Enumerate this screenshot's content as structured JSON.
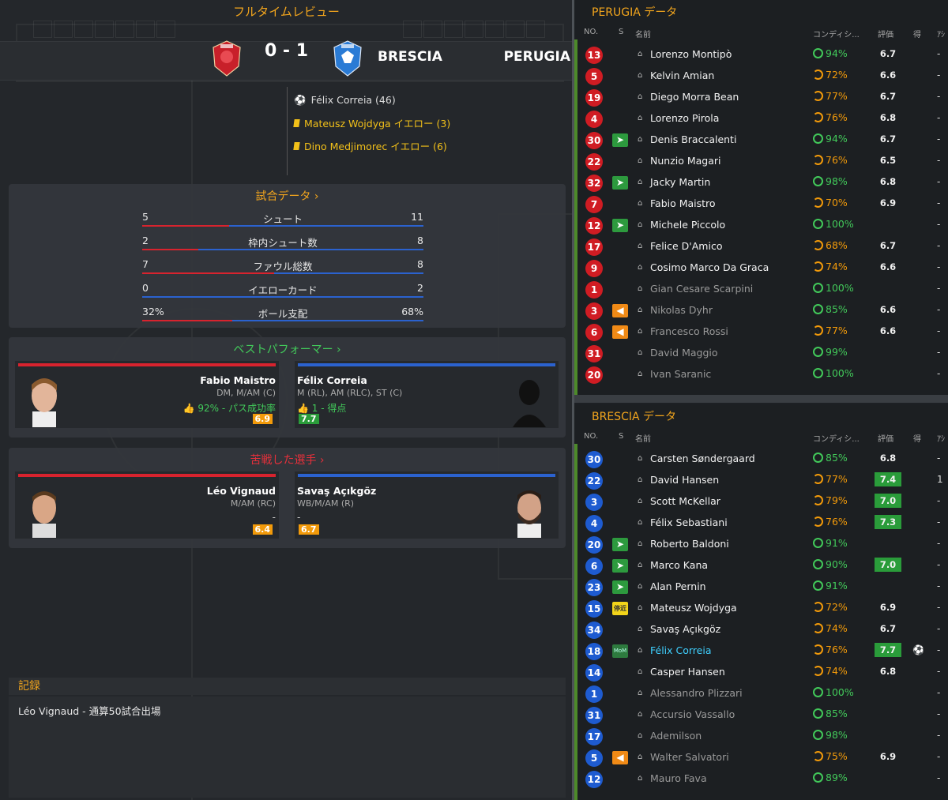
{
  "page_title": "フルタイムレビュー",
  "match": {
    "home_team": "PERUGIA",
    "away_team": "BRESCIA",
    "score": "0 - 1",
    "home_color": "#d8232e",
    "away_color": "#2b62cf"
  },
  "events": [
    {
      "text": "Félix Correia (46)",
      "type": "goal",
      "icon": "ball-icon"
    },
    {
      "text": "Mateusz Wojdyga イエロー (3)",
      "type": "yellow",
      "icon": "yellow-card-icon"
    },
    {
      "text": "Dino Medjimorec イエロー (6)",
      "type": "yellow",
      "icon": "yellow-card-icon"
    }
  ],
  "match_stats": {
    "header": "試合データ",
    "rows": [
      {
        "label": "シュート",
        "home": "5",
        "away": "11",
        "home_share": 0.31
      },
      {
        "label": "枠内シュート数",
        "home": "2",
        "away": "8",
        "home_share": 0.2
      },
      {
        "label": "ファウル総数",
        "home": "7",
        "away": "8",
        "home_share": 0.47
      },
      {
        "label": "イエローカード",
        "home": "0",
        "away": "2",
        "home_share": 0.0
      },
      {
        "label": "ボール支配",
        "home": "32%",
        "away": "68%",
        "home_share": 0.32
      }
    ]
  },
  "best": {
    "header": "ベストパフォーマー",
    "home": {
      "name": "Fabio Maistro",
      "pos": "DM, M/AM (C)",
      "stat": "92% - パス成功率",
      "rating": "6.9"
    },
    "away": {
      "name": "Félix Correia",
      "pos": "M (RL), AM (RLC), ST (C)",
      "stat": "1 - 得点",
      "rating": "7.7"
    }
  },
  "struggled": {
    "header": "苦戦した選手",
    "home": {
      "name": "Léo Vignaud",
      "pos": "M/AM (RC)",
      "stat": "-",
      "rating": "6.4"
    },
    "away": {
      "name": "Savaş Açıkgöz",
      "pos": "WB/M/AM (R)",
      "stat": "-",
      "rating": "6.7"
    }
  },
  "record": {
    "header": "記録",
    "text": "Léo Vignaud - 通算50試合出場"
  },
  "columns": {
    "no": "NO.",
    "s": "S",
    "name": "名前",
    "cond": "コンディシ...",
    "rating": "評価",
    "goals": "得",
    "assists": "ｱｼ"
  },
  "perugia": {
    "title": "PERUGIA データ",
    "players": [
      {
        "no": "13",
        "sub": "",
        "name": "Lorenzo Montipò",
        "cond": "94%",
        "rating": "6.7",
        "goals": "",
        "assists": "-"
      },
      {
        "no": "5",
        "sub": "",
        "name": "Kelvin Amian",
        "cond": "72%",
        "rating": "6.6",
        "goals": "",
        "assists": "-"
      },
      {
        "no": "19",
        "sub": "",
        "name": "Diego Morra Bean",
        "cond": "77%",
        "rating": "6.7",
        "goals": "",
        "assists": "-"
      },
      {
        "no": "4",
        "sub": "",
        "name": "Lorenzo Pirola",
        "cond": "76%",
        "rating": "6.8",
        "goals": "",
        "assists": "-"
      },
      {
        "no": "30",
        "sub": "in",
        "name": "Denis Braccalenti",
        "cond": "94%",
        "rating": "6.7",
        "goals": "",
        "assists": "-"
      },
      {
        "no": "22",
        "sub": "",
        "name": "Nunzio Magari",
        "cond": "76%",
        "rating": "6.5",
        "goals": "",
        "assists": "-"
      },
      {
        "no": "32",
        "sub": "in",
        "name": "Jacky Martin",
        "cond": "98%",
        "rating": "6.8",
        "goals": "",
        "assists": "-"
      },
      {
        "no": "7",
        "sub": "",
        "name": "Fabio Maistro",
        "cond": "70%",
        "rating": "6.9",
        "goals": "",
        "assists": "-"
      },
      {
        "no": "12",
        "sub": "in",
        "name": "Michele Piccolo",
        "cond": "100%",
        "rating": "",
        "goals": "",
        "assists": "-"
      },
      {
        "no": "17",
        "sub": "",
        "name": "Felice D'Amico",
        "cond": "68%",
        "rating": "6.7",
        "goals": "",
        "assists": "-"
      },
      {
        "no": "9",
        "sub": "",
        "name": "Cosimo Marco Da Graca",
        "cond": "74%",
        "rating": "6.6",
        "goals": "",
        "assists": "-"
      },
      {
        "no": "1",
        "sub": "",
        "name": "Gian Cesare Scarpini",
        "cond": "100%",
        "rating": "",
        "goals": "",
        "assists": "-",
        "dim": true
      },
      {
        "no": "3",
        "sub": "out",
        "name": "Nikolas Dyhr",
        "cond": "85%",
        "rating": "6.6",
        "goals": "",
        "assists": "-",
        "dim": true
      },
      {
        "no": "6",
        "sub": "out",
        "name": "Francesco Rossi",
        "cond": "77%",
        "rating": "6.6",
        "goals": "",
        "assists": "-",
        "dim": true
      },
      {
        "no": "31",
        "sub": "",
        "name": "David Maggio",
        "cond": "99%",
        "rating": "",
        "goals": "",
        "assists": "-",
        "dim": true
      },
      {
        "no": "20",
        "sub": "",
        "name": "Ivan Saranic",
        "cond": "100%",
        "rating": "",
        "goals": "",
        "assists": "-",
        "dim": true
      }
    ]
  },
  "brescia": {
    "title": "BRESCIA データ",
    "players": [
      {
        "no": "30",
        "sub": "",
        "name": "Carsten Søndergaard",
        "cond": "85%",
        "rating": "6.8",
        "goals": "",
        "assists": "-"
      },
      {
        "no": "22",
        "sub": "",
        "name": "David Hansen",
        "cond": "77%",
        "rating": "7.4",
        "goals": "",
        "assists": "1",
        "best": true
      },
      {
        "no": "3",
        "sub": "",
        "name": "Scott McKellar",
        "cond": "79%",
        "rating": "7.0",
        "goals": "",
        "assists": "-",
        "best": true
      },
      {
        "no": "4",
        "sub": "",
        "name": "Félix Sebastiani",
        "cond": "76%",
        "rating": "7.3",
        "goals": "",
        "assists": "-",
        "best": true
      },
      {
        "no": "20",
        "sub": "in",
        "name": "Roberto Baldoni",
        "cond": "91%",
        "rating": "",
        "goals": "",
        "assists": "-"
      },
      {
        "no": "6",
        "sub": "in",
        "name": "Marco Kana",
        "cond": "90%",
        "rating": "7.0",
        "goals": "",
        "assists": "-",
        "best": true
      },
      {
        "no": "23",
        "sub": "in",
        "name": "Alan Pernin",
        "cond": "91%",
        "rating": "",
        "goals": "",
        "assists": "-"
      },
      {
        "no": "15",
        "sub": "sus",
        "sub_label": "停近",
        "name": "Mateusz Wojdyga",
        "cond": "72%",
        "rating": "6.9",
        "goals": "",
        "assists": "-"
      },
      {
        "no": "34",
        "sub": "",
        "name": "Savaş Açıkgöz",
        "cond": "74%",
        "rating": "6.7",
        "goals": "",
        "assists": "-"
      },
      {
        "no": "18",
        "sub": "mom",
        "sub_label": "MoM",
        "name": "Félix Correia",
        "cond": "76%",
        "rating": "7.7",
        "goals": "⚽",
        "assists": "-",
        "best": true,
        "hl": true
      },
      {
        "no": "14",
        "sub": "",
        "name": "Casper Hansen",
        "cond": "74%",
        "rating": "6.8",
        "goals": "",
        "assists": "-"
      },
      {
        "no": "1",
        "sub": "",
        "name": "Alessandro Plizzari",
        "cond": "100%",
        "rating": "",
        "goals": "",
        "assists": "-",
        "dim": true
      },
      {
        "no": "31",
        "sub": "",
        "name": "Accursio Vassallo",
        "cond": "85%",
        "rating": "",
        "goals": "",
        "assists": "-",
        "dim": true
      },
      {
        "no": "17",
        "sub": "",
        "name": "Ademilson",
        "cond": "98%",
        "rating": "",
        "goals": "",
        "assists": "-",
        "dim": true
      },
      {
        "no": "5",
        "sub": "out",
        "name": "Walter Salvatori",
        "cond": "75%",
        "rating": "6.9",
        "goals": "",
        "assists": "-",
        "dim": true
      },
      {
        "no": "12",
        "sub": "",
        "name": "Mauro Fava",
        "cond": "89%",
        "rating": "",
        "goals": "",
        "assists": "-",
        "dim": true
      }
    ]
  }
}
